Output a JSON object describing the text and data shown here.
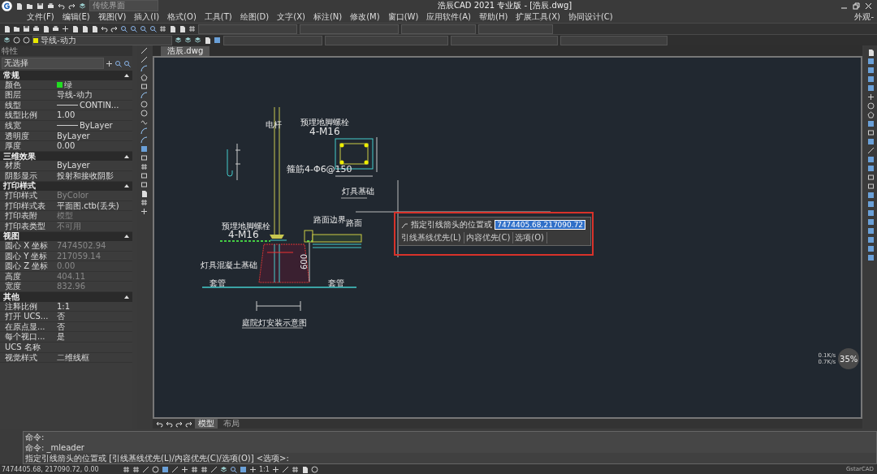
{
  "title_bar": {
    "workspace": "传统界面",
    "title": "浩辰CAD 2021 专业版 - [浩辰.dwg]"
  },
  "menu_bar": {
    "items": [
      "文件(F)",
      "编辑(E)",
      "视图(V)",
      "插入(I)",
      "格式(O)",
      "工具(T)",
      "绘图(D)",
      "文字(X)",
      "标注(N)",
      "修改(M)",
      "窗口(W)",
      "应用软件(A)",
      "帮助(H)",
      "扩展工具(X)",
      "协同设计(C)"
    ],
    "appearance": "外观-"
  },
  "layer_bar": {
    "layer": "导线-动力"
  },
  "properties": {
    "title": "特性",
    "selection": "无选择",
    "sections": [
      {
        "title": "常规",
        "expanded": true,
        "rows": [
          {
            "label": "颜色",
            "value": "绿",
            "kind": "color",
            "color": "#22dd22",
            "disabled": false
          },
          {
            "label": "图层",
            "value": "导线-动力",
            "kind": "text",
            "disabled": false
          },
          {
            "label": "线型",
            "value": "CONTIN...",
            "kind": "linetype",
            "disabled": false
          },
          {
            "label": "线型比例",
            "value": "1.00",
            "kind": "text",
            "disabled": false
          },
          {
            "label": "线宽",
            "value": "ByLayer",
            "kind": "linetype",
            "disabled": false
          },
          {
            "label": "透明度",
            "value": "ByLayer",
            "kind": "text",
            "disabled": false
          },
          {
            "label": "厚度",
            "value": "0.00",
            "kind": "text",
            "disabled": false
          }
        ]
      },
      {
        "title": "三维效果",
        "expanded": true,
        "rows": [
          {
            "label": "材质",
            "value": "ByLayer",
            "kind": "text",
            "disabled": false
          },
          {
            "label": "阴影显示",
            "value": "投射和接收阴影",
            "kind": "text",
            "disabled": false
          }
        ]
      },
      {
        "title": "打印样式",
        "expanded": true,
        "rows": [
          {
            "label": "打印样式",
            "value": "ByColor",
            "kind": "text",
            "disabled": true
          },
          {
            "label": "打印样式表",
            "value": "平面图.ctb(丢失)",
            "kind": "text",
            "disabled": false
          },
          {
            "label": "打印表附",
            "value": "模型",
            "kind": "text",
            "disabled": true
          },
          {
            "label": "打印表类型",
            "value": "不可用",
            "kind": "text",
            "disabled": true
          }
        ]
      },
      {
        "title": "视图",
        "expanded": true,
        "rows": [
          {
            "label": "圆心 X 坐标",
            "value": "7474502.94",
            "kind": "text",
            "disabled": true
          },
          {
            "label": "圆心 Y 坐标",
            "value": "217059.14",
            "kind": "text",
            "disabled": true
          },
          {
            "label": "圆心 Z 坐标",
            "value": "0.00",
            "kind": "text",
            "disabled": true
          },
          {
            "label": "高度",
            "value": "404.11",
            "kind": "text",
            "disabled": true
          },
          {
            "label": "宽度",
            "value": "832.96",
            "kind": "text",
            "disabled": true
          }
        ]
      },
      {
        "title": "其他",
        "expanded": true,
        "rows": [
          {
            "label": "注释比例",
            "value": "1:1",
            "kind": "text",
            "disabled": false
          },
          {
            "label": "打开 UCS...",
            "value": "否",
            "kind": "text",
            "disabled": false
          },
          {
            "label": "在原点显...",
            "value": "否",
            "kind": "text",
            "disabled": false
          },
          {
            "label": "每个视口...",
            "value": "是",
            "kind": "text",
            "disabled": false
          },
          {
            "label": "UCS 名称",
            "kind": "text"
          },
          {
            "label": "视觉样式",
            "value": "二维线框",
            "kind": "text",
            "disabled": false
          }
        ]
      }
    ]
  },
  "document_tab": {
    "label": "浩辰.dwg"
  },
  "drawing": {
    "labels": [
      "电杆",
      "预埋地脚螺栓",
      "4-M16",
      "箍筋4-Φ6@150",
      "灯具基础",
      "预埋地脚螺栓",
      "4-M16",
      "路面边界",
      "路面",
      "灯具混凝土基础",
      "套管",
      "套管",
      "600",
      "庭院灯安装示意图"
    ]
  },
  "prompt": {
    "label": "指定引线箭头的位置或",
    "value": "7474405.68,217090.72",
    "options": [
      "引线基线优先(L)",
      "内容优先(C)",
      "选项(O)"
    ]
  },
  "zoom_widget": {
    "percent": "35%",
    "upload": "0.1K/s",
    "download": "0.7K/s"
  },
  "layout_tabs": [
    {
      "label": "模型",
      "selected": true
    },
    {
      "label": "布局",
      "selected": false
    }
  ],
  "command_lines": [
    "命令:",
    "命令: _mleader",
    "指定引线箭头的位置或 [引线基线优先(L)/内容优先(C)/选项(O)] <选项>:"
  ],
  "status_bar": {
    "coordinates": "7474405.68, 217090.72, 0.00",
    "scale": "1:1",
    "brand": "GstarCAD"
  }
}
